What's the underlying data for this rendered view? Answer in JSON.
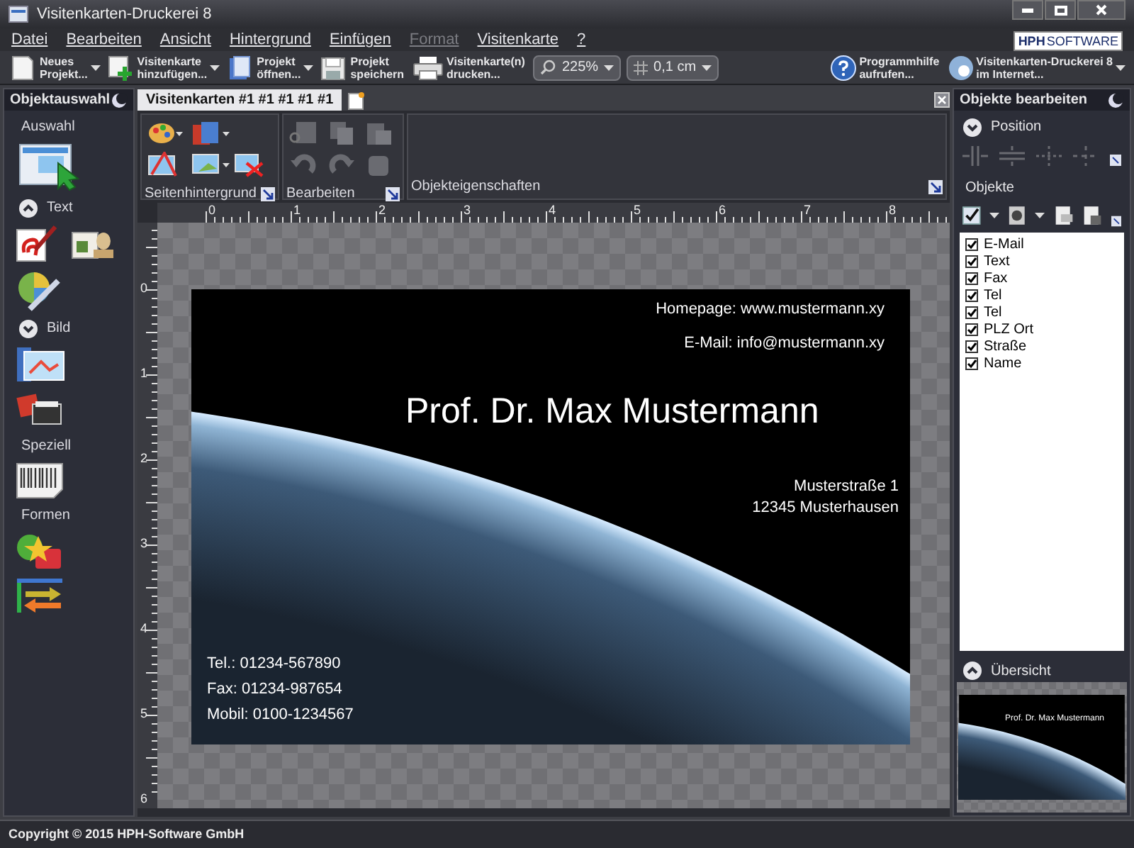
{
  "window": {
    "title": "Visitenkarten-Druckerei 8"
  },
  "menu": [
    {
      "label": "Datei",
      "disabled": false
    },
    {
      "label": "Bearbeiten",
      "disabled": false
    },
    {
      "label": "Ansicht",
      "disabled": false
    },
    {
      "label": "Hintergrund",
      "disabled": false
    },
    {
      "label": "Einfügen",
      "disabled": false
    },
    {
      "label": "Format",
      "disabled": true
    },
    {
      "label": "Visitenkarte",
      "disabled": false
    },
    {
      "label": "?",
      "disabled": false
    }
  ],
  "logo": {
    "bold": "HPH",
    "light": "SOFTWARE"
  },
  "toolbar": {
    "left": [
      {
        "kind": "button",
        "lines": [
          "Neues",
          "Projekt..."
        ],
        "dropdown": true
      },
      {
        "kind": "button",
        "lines": [
          "Visitenkarte",
          "hinzufügen..."
        ],
        "dropdown": true
      },
      {
        "kind": "button",
        "lines": [
          "Projekt",
          "öffnen..."
        ],
        "dropdown": true
      },
      {
        "kind": "button",
        "lines": [
          "Projekt",
          "speichern"
        ],
        "dropdown": false
      },
      {
        "kind": "button",
        "lines": [
          "Visitenkarte(n)",
          "drucken..."
        ],
        "dropdown": false
      },
      {
        "kind": "combo",
        "value": "225%"
      },
      {
        "kind": "combo",
        "value": "0,1 cm"
      }
    ],
    "right": [
      {
        "kind": "button",
        "lines": [
          "Programmhilfe",
          "aufrufen..."
        ],
        "dropdown": false
      },
      {
        "kind": "button",
        "lines": [
          "Visitenkarten-Druckerei 8",
          "im Internet..."
        ],
        "dropdown": true
      }
    ]
  },
  "left_panel": {
    "title": "Objektauswahl",
    "sections": [
      {
        "label": "Auswahl"
      },
      {
        "label": "Text",
        "expanded": true
      },
      {
        "label": "Bild",
        "expanded": false
      },
      {
        "label": "Speziell"
      },
      {
        "label": "Formen"
      }
    ]
  },
  "document_tab": {
    "label": "Visitenkarten #1 #1 #1 #1 #1",
    "selected": true
  },
  "ribbon": {
    "groups": [
      {
        "label": "Seitenhintergrund"
      },
      {
        "label": "Bearbeiten"
      },
      {
        "label": "Objekteigenschaften"
      }
    ]
  },
  "rulers": {
    "horizontal": [
      "0",
      "1",
      "2",
      "3",
      "4",
      "5",
      "6",
      "7",
      "8"
    ],
    "vertical": [
      "0",
      "1",
      "2",
      "3",
      "4",
      "5",
      "6"
    ]
  },
  "card": {
    "homepage": "Homepage: www.mustermann.xy",
    "email": "E-Mail: info@mustermann.xy",
    "name": "Prof. Dr. Max Mustermann",
    "street": "Musterstraße 1",
    "city": "12345 Musterhausen",
    "phone": "Tel.: 01234-567890",
    "fax": "Fax: 01234-987654",
    "mobile": "Mobil: 0100-1234567"
  },
  "right_panel": {
    "title": "Objekte bearbeiten",
    "position": {
      "label": "Position",
      "expanded": false
    },
    "objects_label": "Objekte",
    "objects": [
      {
        "label": "E-Mail",
        "checked": true
      },
      {
        "label": "Text",
        "checked": true
      },
      {
        "label": "Fax",
        "checked": true
      },
      {
        "label": "Tel",
        "checked": true
      },
      {
        "label": "Tel",
        "checked": true
      },
      {
        "label": "PLZ Ort",
        "checked": true
      },
      {
        "label": "Straße",
        "checked": true
      },
      {
        "label": "Name",
        "checked": true
      }
    ],
    "overview": {
      "label": "Übersicht",
      "expanded": true,
      "name": "Prof. Dr. Max Mustermann"
    }
  },
  "status_bar": {
    "text": "Copyright © 2015 HPH-Software GmbH"
  }
}
